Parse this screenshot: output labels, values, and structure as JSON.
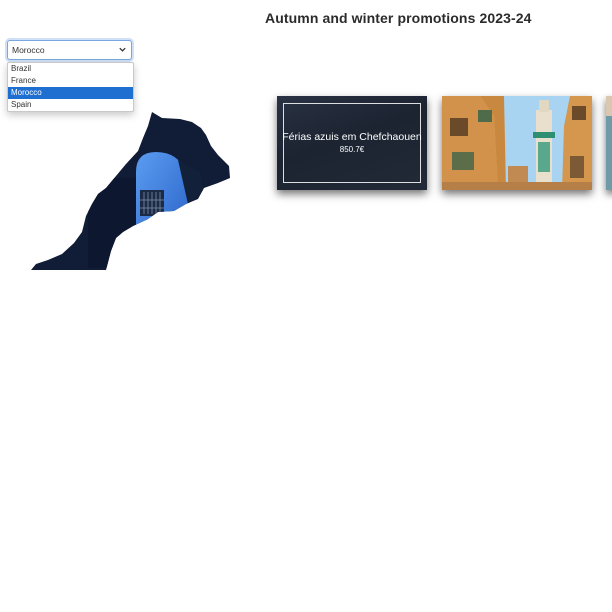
{
  "page": {
    "title": "Autumn and winter promotions 2023-24"
  },
  "country_select": {
    "value": "Morocco",
    "options": [
      "Brazil",
      "France",
      "Morocco",
      "Spain"
    ],
    "selected_index": 2
  },
  "cards": [
    {
      "title": "Férias azuis em Chefchaouen",
      "price": "850.7€"
    },
    {
      "title": "",
      "price": ""
    }
  ],
  "colors": {
    "select_highlight": "#1f6fd0",
    "map_fill": "#101c34",
    "door_blue": "#3a82e8"
  },
  "icons": {
    "select_arrow": "chevron-down-icon"
  }
}
